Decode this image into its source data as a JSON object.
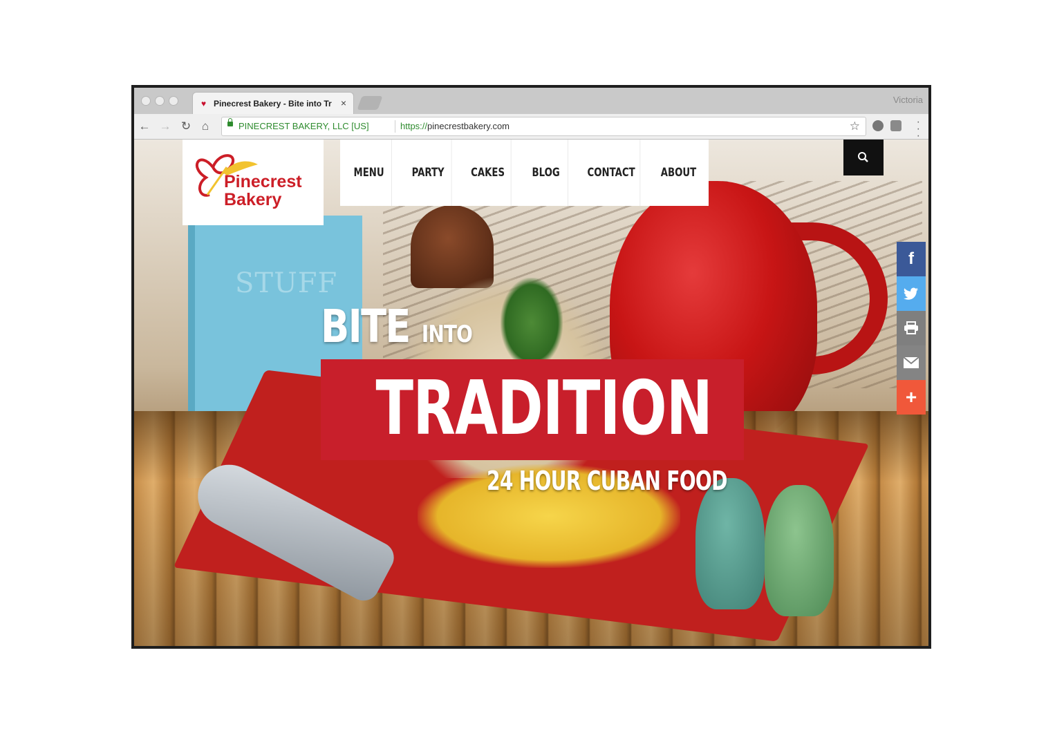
{
  "browser": {
    "tab_title": "Pinecrest Bakery - Bite into Tr",
    "tab_close": "×",
    "profile_name": "Victoria",
    "ev_label": "PINECREST BAKERY, LLC [US]",
    "url_protocol": "https://",
    "url_host": "pinecrestbakery.com",
    "back": "←",
    "forward": "→",
    "reload": "↻",
    "home": "⌂",
    "star": "☆"
  },
  "site": {
    "logo": {
      "line1": "Pinecrest",
      "line2": "Bakery",
      "color": "#cc1e27"
    },
    "nav": [
      "MENU",
      "PARTY",
      "CAKES",
      "BLOG",
      "CONTACT",
      "ABOUT"
    ],
    "search_icon": "search-icon",
    "social": [
      {
        "name": "facebook-icon",
        "glyph": "f",
        "color": "#3b5998"
      },
      {
        "name": "twitter-icon",
        "glyph": "twitter",
        "color": "#55acee"
      },
      {
        "name": "print-icon",
        "glyph": "print",
        "color": "#7f7f7f"
      },
      {
        "name": "email-icon",
        "glyph": "mail",
        "color": "#848484"
      },
      {
        "name": "more-share-icon",
        "glyph": "+",
        "color": "#f0583a"
      }
    ],
    "hero": {
      "bite": "BITE",
      "into": "INTO",
      "tradition": "TRADITION",
      "subtitle": "24 HOUR CUBAN FOOD",
      "banner_color": "#c81f2b"
    },
    "photo_book_text": "STUFF"
  }
}
